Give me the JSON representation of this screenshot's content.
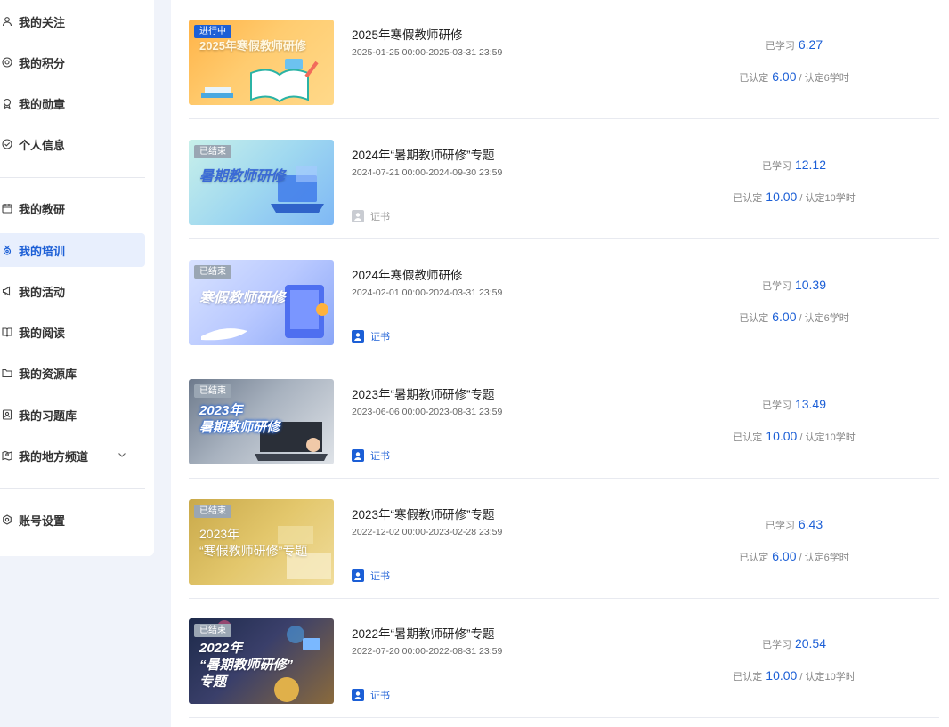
{
  "sidebar": {
    "items": [
      {
        "label": "我的关注",
        "icon": "user-icon"
      },
      {
        "label": "我的积分",
        "icon": "points-icon"
      },
      {
        "label": "我的勋章",
        "icon": "medal-icon"
      },
      {
        "label": "个人信息",
        "icon": "check-circle-icon"
      },
      {
        "label": "我的教研",
        "icon": "calendar-icon"
      },
      {
        "label": "我的培训",
        "icon": "training-medal-icon",
        "active": true
      },
      {
        "label": "我的活动",
        "icon": "megaphone-icon"
      },
      {
        "label": "我的阅读",
        "icon": "book-icon"
      },
      {
        "label": "我的资源库",
        "icon": "folder-icon"
      },
      {
        "label": "我的习题库",
        "icon": "exercise-icon"
      },
      {
        "label": "我的地方频道",
        "icon": "map-icon"
      },
      {
        "label": "账号设置",
        "icon": "settings-icon"
      }
    ]
  },
  "common": {
    "studied_label": "已学习",
    "certified_label": "已认定",
    "cert_label": "证书"
  },
  "trainings": [
    {
      "title": "2025年寒假教师研修",
      "date": "2025-01-25 00:00-2025-03-31 23:59",
      "badge": "进行中",
      "thumb_text": "2025年寒假教师研修",
      "studied": "6.27",
      "certified": "6.00",
      "required": "/ 认定6学时",
      "cert": false
    },
    {
      "title": "2024年“暑期教师研修”专题",
      "date": "2024-07-21 00:00-2024-09-30 23:59",
      "badge": "已结束",
      "thumb_text": "暑期教师研修",
      "studied": "12.12",
      "certified": "10.00",
      "required": "/ 认定10学时",
      "cert": true,
      "cert_enabled": false
    },
    {
      "title": "2024年寒假教师研修",
      "date": "2024-02-01 00:00-2024-03-31 23:59",
      "badge": "已结束",
      "thumb_text": "寒假教师研修",
      "studied": "10.39",
      "certified": "6.00",
      "required": "/ 认定6学时",
      "cert": true,
      "cert_enabled": true
    },
    {
      "title": "2023年“暑期教师研修”专题",
      "date": "2023-06-06 00:00-2023-08-31 23:59",
      "badge": "已结束",
      "thumb_text": "2023年\n暑期教师研修",
      "studied": "13.49",
      "certified": "10.00",
      "required": "/ 认定10学时",
      "cert": true,
      "cert_enabled": true
    },
    {
      "title": "2023年“寒假教师研修”专题",
      "date": "2022-12-02 00:00-2023-02-28 23:59",
      "badge": "已结束",
      "thumb_text": "2023年\n“寒假教师研修”专题",
      "studied": "6.43",
      "certified": "6.00",
      "required": "/ 认定6学时",
      "cert": true,
      "cert_enabled": true
    },
    {
      "title": "2022年“暑期教师研修”专题",
      "date": "2022-07-20 00:00-2022-08-31 23:59",
      "badge": "已结束",
      "thumb_text": "2022年\n“暑期教师研修”\n专题",
      "studied": "20.54",
      "certified": "10.00",
      "required": "/ 认定10学时",
      "cert": true,
      "cert_enabled": true
    }
  ],
  "colors": {
    "accent": "#1c5fd6",
    "active_bg": "#e8effd"
  }
}
